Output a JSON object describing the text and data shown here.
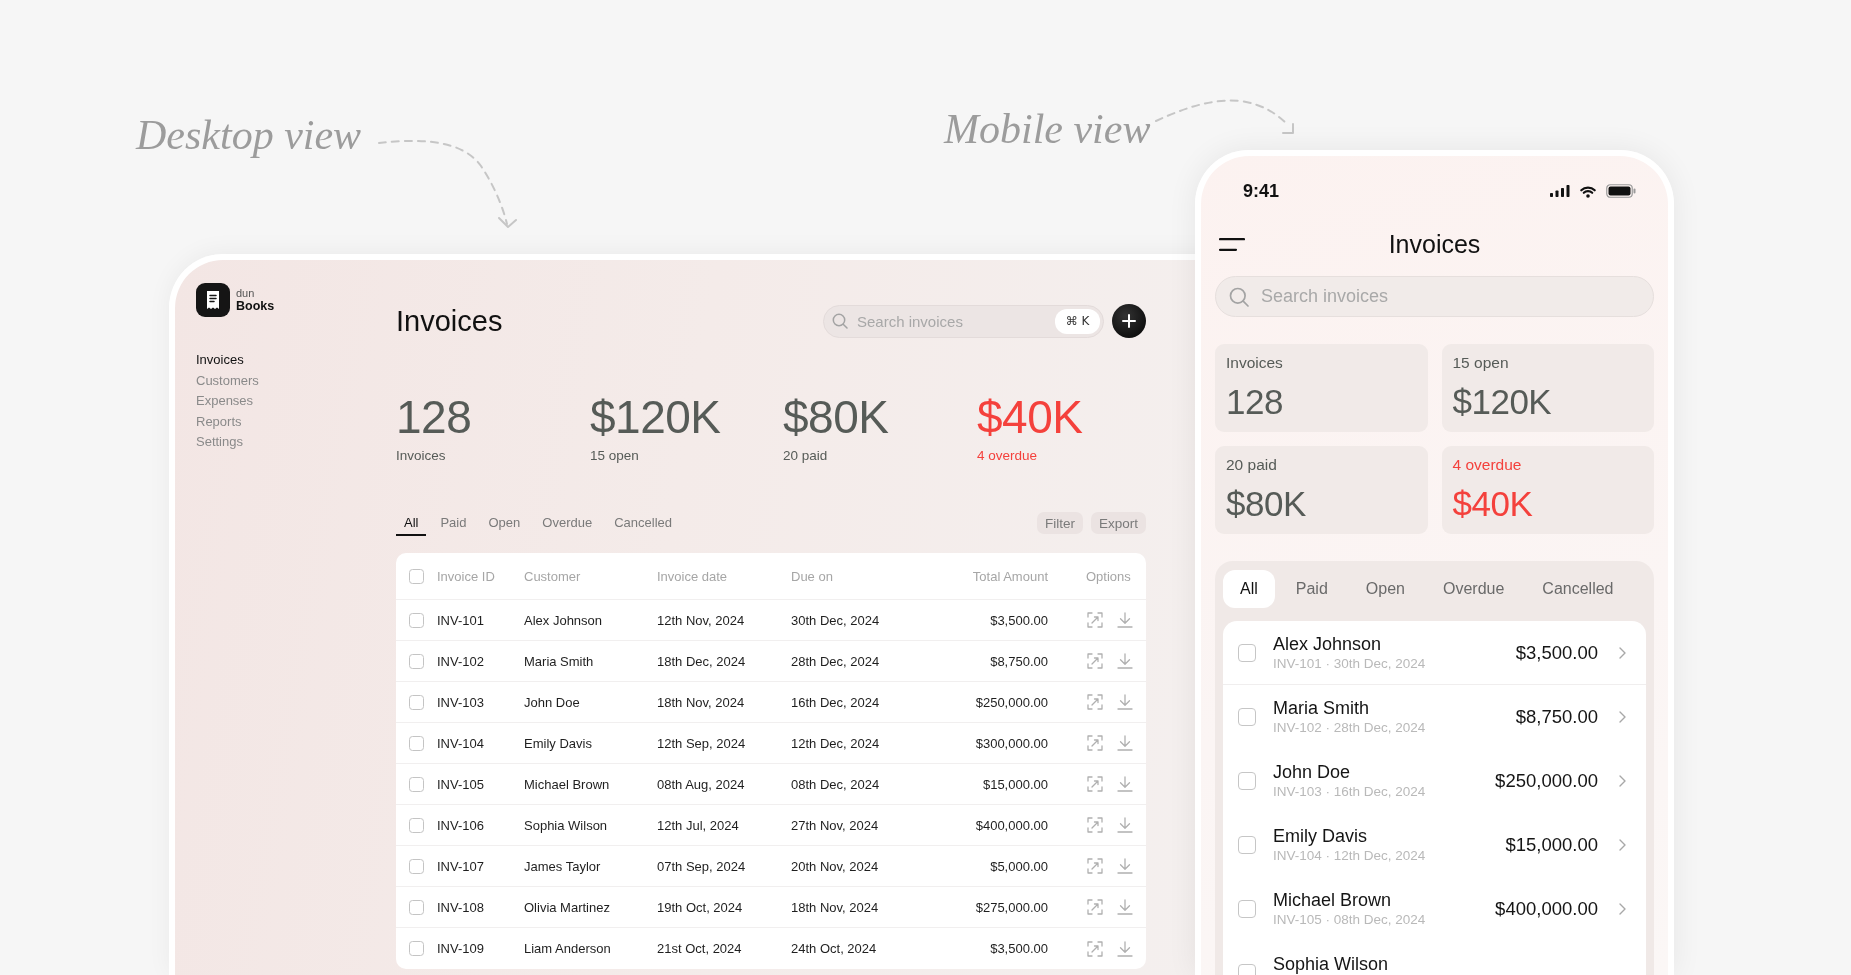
{
  "annotations": [
    {
      "text": "Desktop view"
    },
    {
      "text": "Mobile view"
    }
  ],
  "desktop": {
    "brand": {
      "prefix": "dun",
      "name": "Books"
    },
    "nav": [
      {
        "label": "Invoices",
        "selected": true
      },
      {
        "label": "Customers",
        "selected": false
      },
      {
        "label": "Expenses",
        "selected": false
      },
      {
        "label": "Reports",
        "selected": false
      },
      {
        "label": "Settings",
        "selected": false
      }
    ],
    "title": "Invoices",
    "search": {
      "placeholder": "Search invoices",
      "shortcut": "⌘ K"
    },
    "stats": [
      {
        "value": "128",
        "label": "Invoices",
        "color": "#565b57"
      },
      {
        "value": "$120K",
        "label": "15 open",
        "color": "#565b57"
      },
      {
        "value": "$80K",
        "label": "20 paid",
        "color": "#565b57"
      },
      {
        "value": "$40K",
        "label": "4 overdue",
        "color": "#f4413c"
      }
    ],
    "tabs": [
      {
        "label": "All",
        "selected": true
      },
      {
        "label": "Paid",
        "selected": false
      },
      {
        "label": "Open",
        "selected": false
      },
      {
        "label": "Overdue",
        "selected": false
      },
      {
        "label": "Cancelled",
        "selected": false
      }
    ],
    "actions": [
      {
        "label": "Filter"
      },
      {
        "label": "Export"
      }
    ],
    "table": {
      "all_checked": false,
      "columns": [
        "Invoice ID",
        "Customer",
        "Invoice date",
        "Due on",
        "Total Amount",
        "Options"
      ],
      "rows": [
        {
          "checked": false,
          "cells": [
            "INV-101",
            "Alex Johnson",
            "12th Nov, 2024",
            "30th Dec, 2024",
            "$3,500.00"
          ]
        },
        {
          "checked": false,
          "cells": [
            "INV-102",
            "Maria Smith",
            "18th Dec, 2024",
            "28th Dec, 2024",
            "$8,750.00"
          ]
        },
        {
          "checked": false,
          "cells": [
            "INV-103",
            "John Doe",
            "18th Nov, 2024",
            "16th Dec, 2024",
            "$250,000.00"
          ]
        },
        {
          "checked": false,
          "cells": [
            "INV-104",
            "Emily Davis",
            "12th Sep, 2024",
            "12th Dec, 2024",
            "$300,000.00"
          ]
        },
        {
          "checked": false,
          "cells": [
            "INV-105",
            "Michael Brown",
            "08th Aug, 2024",
            "08th Dec, 2024",
            "$15,000.00"
          ]
        },
        {
          "checked": false,
          "cells": [
            "INV-106",
            "Sophia Wilson",
            "12th Jul, 2024",
            "27th Nov, 2024",
            "$400,000.00"
          ]
        },
        {
          "checked": false,
          "cells": [
            "INV-107",
            "James Taylor",
            "07th Sep, 2024",
            "20th Nov, 2024",
            "$5,000.00"
          ]
        },
        {
          "checked": false,
          "cells": [
            "INV-108",
            "Olivia Martinez",
            "19th Oct, 2024",
            "18th Nov, 2024",
            "$275,000.00"
          ]
        },
        {
          "checked": false,
          "cells": [
            "INV-109",
            "Liam Anderson",
            "21st Oct, 2024",
            "24th Oct, 2024",
            "$3,500.00"
          ]
        }
      ]
    }
  },
  "mobile": {
    "status_bar": {
      "time": "9:41"
    },
    "title": "Invoices",
    "search": {
      "placeholder": "Search invoices"
    },
    "stats": [
      {
        "label": "Invoices",
        "value": "128",
        "color": "#565b57"
      },
      {
        "label": "15 open",
        "value": "$120K",
        "color": "#565b57"
      },
      {
        "label": "20 paid",
        "value": "$80K",
        "color": "#565b57"
      },
      {
        "label": "4 overdue",
        "value": "$40K",
        "color": "#f4413c"
      }
    ],
    "tabs": [
      {
        "label": "All",
        "selected": true
      },
      {
        "label": "Paid",
        "selected": false
      },
      {
        "label": "Open",
        "selected": false
      },
      {
        "label": "Overdue",
        "selected": false
      },
      {
        "label": "Cancelled",
        "selected": false
      }
    ],
    "rows": [
      {
        "checked": false,
        "name": "Alex Johnson",
        "meta": "INV-101 · 30th Dec, 2024",
        "amount": "$3,500.00"
      },
      {
        "checked": false,
        "name": "Maria Smith",
        "meta": "INV-102 · 28th Dec, 2024",
        "amount": "$8,750.00"
      },
      {
        "checked": false,
        "name": "John Doe",
        "meta": "INV-103 · 16th Dec, 2024",
        "amount": "$250,000.00"
      },
      {
        "checked": false,
        "name": "Emily Davis",
        "meta": "INV-104 · 12th Dec, 2024",
        "amount": "$15,000.00"
      },
      {
        "checked": false,
        "name": "Michael Brown",
        "meta": "INV-105 · 08th Dec, 2024",
        "amount": "$400,000.00"
      },
      {
        "checked": false,
        "name": "Sophia Wilson"
      }
    ]
  }
}
